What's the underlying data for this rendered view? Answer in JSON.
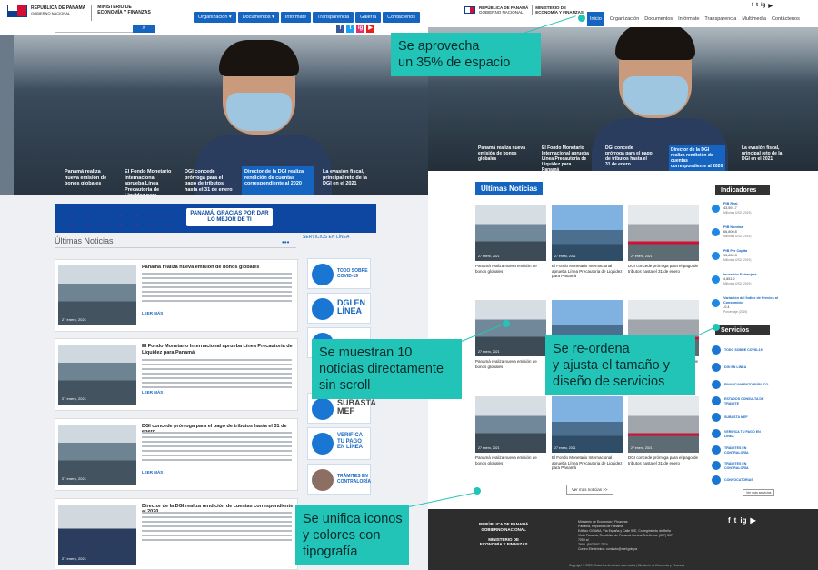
{
  "left": {
    "logo": {
      "line1": "REPÚBLICA DE PANAMÁ",
      "line2": "GOBIERNO NACIONAL"
    },
    "ministry": "MINISTERIO DE\nECONOMÍA Y FINANZAS",
    "nav": [
      "Organización ▾",
      "Documentos ▾",
      "Infórmate",
      "Transparencia",
      "Galería",
      "Contáctenos"
    ],
    "social": [
      "f",
      "t",
      "ig",
      "▶"
    ],
    "hero_captions": [
      "Panamá realiza nueva emisión de bonos globales",
      "El Fondo Monetario Internacional aprueba Línea Precautoria de Liquidez para Panamá",
      "DGI concede prórroga para el pago de tributos hasta el 31 de enero",
      "Director de la DGI realiza rendición de cuentas correspondiente al 2020",
      "La evasión fiscal, principal reto de la DGI en el 2021"
    ],
    "banner": "PANAMÁ, GRACIAS POR DAR LO MEJOR DE TI",
    "news_title": "Últimas Noticias",
    "dots": "•••",
    "services_title": "SERVICIOS EN LÍNEA",
    "cards": [
      {
        "title": "Panamá realiza nueva emisión de bonos globales",
        "date": "27 enero, 2021",
        "more": "LEER MÁS"
      },
      {
        "title": "El Fondo Monetario Internacional aprueba Línea Precautoria de Liquidez para Panamá",
        "date": "27 enero, 2021",
        "more": "LEER MÁS"
      },
      {
        "title": "DGI concede prórroga para el pago de tributos hasta el 31 de enero",
        "date": "27 enero, 2021",
        "more": "LEER MÁS"
      },
      {
        "title": "Director de la DGI realiza rendición de cuentas correspondiente al 2020",
        "date": "27 enero, 2021",
        "more": ""
      }
    ],
    "services": [
      "TODO SOBRE COVID-19",
      "DGI EN LÍNEA",
      "",
      "SUBASTA MEF",
      "VERIFICA TU PAGO EN LÍNEA",
      "TRÁMITES EN CONTRALORÍA"
    ]
  },
  "right": {
    "logo": {
      "line1": "REPÚBLICA DE PANAMÁ",
      "line2": "GOBIERNO NACIONAL"
    },
    "ministry": "MINISTERIO DE\nECONOMÍA Y FINANZAS",
    "nav": [
      "Inicio",
      "Organización",
      "Documentos",
      "Infórmate",
      "Transparencia",
      "Multimedia",
      "Contáctenos"
    ],
    "social": [
      "f",
      "t",
      "ig",
      "▶"
    ],
    "hero_captions": [
      "Panamá realiza nueva emisión de bonos globales",
      "El Fondo Monetario Internacional aprueba Línea Precautoria de Liquidez para Panamá",
      "DGI concede prórroga para el pago de tributos hasta el 31 de enero",
      "Director de la DGI realiza rendición de cuentas correspondiente al 2020",
      "La evasión fiscal, principal reto de la DGI en el 2021"
    ],
    "news_title": "Últimas Noticias",
    "news": [
      "Panamá realiza nueva emisión de bonos globales",
      "El Fondo Monetario Internacional aprueba Línea Precautoria de Liquidez para Panamá",
      "DGI concede prórroga para el pago de tributos hasta el 31 de enero",
      "Panamá realiza nueva emisión de bonos globales",
      "El Fondo Monetario Internacional aprueba Línea Precautoria de Liquidez para Panamá",
      "DGI concede prórroga para el pago de tributos hasta el 31 de enero",
      "Panamá realiza nueva emisión de bonos globales",
      "El Fondo Monetario Internacional aprueba Línea Precautoria de Liquidez para Panamá",
      "DGI concede prórroga para el pago de tributos hasta el 31 de enero"
    ],
    "news_date": "27 enero, 2021",
    "more": "Ver más noticias >>",
    "indicators_title": "Indicadores",
    "indicators": [
      {
        "label": "PIB Real",
        "value": "43,591.7",
        "sub": "Millones USD (2019)"
      },
      {
        "label": "PIB Nominal",
        "value": "66,800.8",
        "sub": "Millones USD (2019)"
      },
      {
        "label": "PIB Per Capita",
        "value": "15,834.3",
        "sub": "Millones USD (2019)"
      },
      {
        "label": "Inversión Extranjera",
        "value": "4,851.2",
        "sub": "Millones USD (2019)"
      },
      {
        "label": "Variación del Índice de Precios al Consumidor",
        "value": "-0.4",
        "sub": "Porcentaje (2019)"
      }
    ],
    "services_title": "Servicios",
    "services": [
      "TODO SOBRE COVID-19",
      "DGI EN LÍNEA",
      "FINANCIAMIENTO PÚBLICO",
      "ESTADOS CONSULTA DE TRÁMITE",
      "SUBASTA MEF",
      "VERIFICA TU PAGO EN LÍNEA",
      "TRÁMITES EN CONTRALORÍA",
      "TRÁMITES EN CONTRALORÍA",
      "CONVOCATORIAS"
    ],
    "services_more": "Ver más servicios",
    "footer": {
      "logo": "REPÚBLICA DE PANAMÁ\nGOBIERNO NACIONAL\n\nMINISTERIO DE\nECONOMÍA Y FINANZAS",
      "lines": [
        "Ministerio de Economía y Finanzas",
        "Panamá, República de Panamá",
        "Edificio OGAWA, Vía España y Calle 52E, Corregimiento de Bella",
        "Vista Panamá, República de Panamá Central Telefónica: (507) 507-7000 al",
        "7600. (507)507-7074",
        "Correo Electrónico: contacto@mef.gob.pa"
      ],
      "social": [
        "f",
        "t",
        "ig",
        "▶"
      ],
      "copyright": "Copyright © 2020. Todos los derechos reservados | Ministerio de Economía y Finanzas"
    }
  },
  "notes": {
    "space": "Se aprovecha\nun 35% de espacio",
    "news": "Se muestran 10\nnoticias directamente\nsin scroll",
    "services": "Se re-ordena\ny ajusta el tamaño y\ndiseño de servicios",
    "icons": "Se unifica iconos\ny colores con\ntipografía"
  },
  "colors": {
    "brand_blue": "#1565c0",
    "accent_teal": "#22c4b8",
    "footer_dark": "#2d2d2d"
  }
}
